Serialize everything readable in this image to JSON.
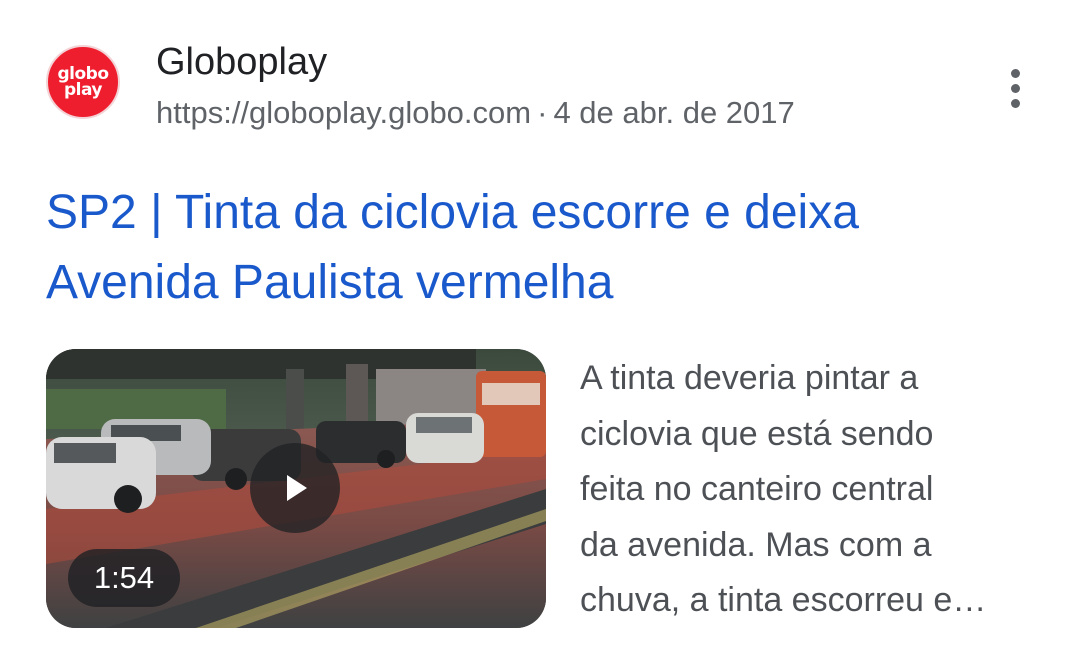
{
  "result": {
    "source": {
      "logo_line1": "globo",
      "logo_line2": "play",
      "name": "Globoplay",
      "url": "https://globoplay.globo.com",
      "separator": "·",
      "date": "4 de abr. de 2017"
    },
    "title": "SP2 | Tinta da ciclovia escorre e deixa Avenida Paulista vermelha",
    "video": {
      "duration": "1:54"
    },
    "snippet_lines": [
      "A tinta deveria pintar a",
      "ciclovia que está sendo",
      "feita no canteiro central",
      "da avenida. Mas com a",
      "chuva, a tinta escorreu e…"
    ]
  },
  "icons": {
    "more": "more-vert-icon",
    "play": "play-icon"
  },
  "colors": {
    "link": "#1a59cc",
    "brand": "#ef1e2f",
    "meta": "#5f6368",
    "snippet": "#4d5156"
  }
}
